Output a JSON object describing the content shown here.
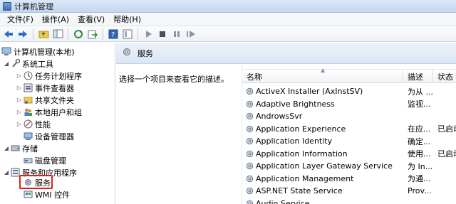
{
  "window": {
    "title": "计算机管理"
  },
  "menu": {
    "items": [
      "文件(F)",
      "操作(A)",
      "查看(V)",
      "帮助(H)"
    ]
  },
  "tree": {
    "root": "计算机管理(本地)",
    "system_tools": "系统工具",
    "task_scheduler": "任务计划程序",
    "event_viewer": "事件查看器",
    "shared_folders": "共享文件夹",
    "local_users": "本地用户和组",
    "performance": "性能",
    "device_manager": "设备管理器",
    "storage": "存储",
    "disk_management": "磁盘管理",
    "services_apps": "服务和应用程序",
    "services": "服务",
    "wmi": "WMI 控件"
  },
  "right": {
    "header": "服务",
    "description_prompt": "选择一个项目来查看它的描述。",
    "columns": {
      "name": "名称",
      "description": "描述",
      "status": "状态"
    },
    "services": [
      {
        "name": "ActiveX Installer (AxInstSV)",
        "description": "为从 ...",
        "status": ""
      },
      {
        "name": "Adaptive Brightness",
        "description": "监视...",
        "status": ""
      },
      {
        "name": "AndrowsSvr",
        "description": "",
        "status": ""
      },
      {
        "name": "Application Experience",
        "description": "在应...",
        "status": "已启动"
      },
      {
        "name": "Application Identity",
        "description": "确定...",
        "status": ""
      },
      {
        "name": "Application Information",
        "description": "使用...",
        "status": "已启动"
      },
      {
        "name": "Application Layer Gateway Service",
        "description": "为 In...",
        "status": ""
      },
      {
        "name": "Application Management",
        "description": "为通...",
        "status": ""
      },
      {
        "name": "ASP.NET State Service",
        "description": "Prov...",
        "status": ""
      },
      {
        "name": "Audio Service",
        "description": "",
        "status": ""
      }
    ]
  }
}
